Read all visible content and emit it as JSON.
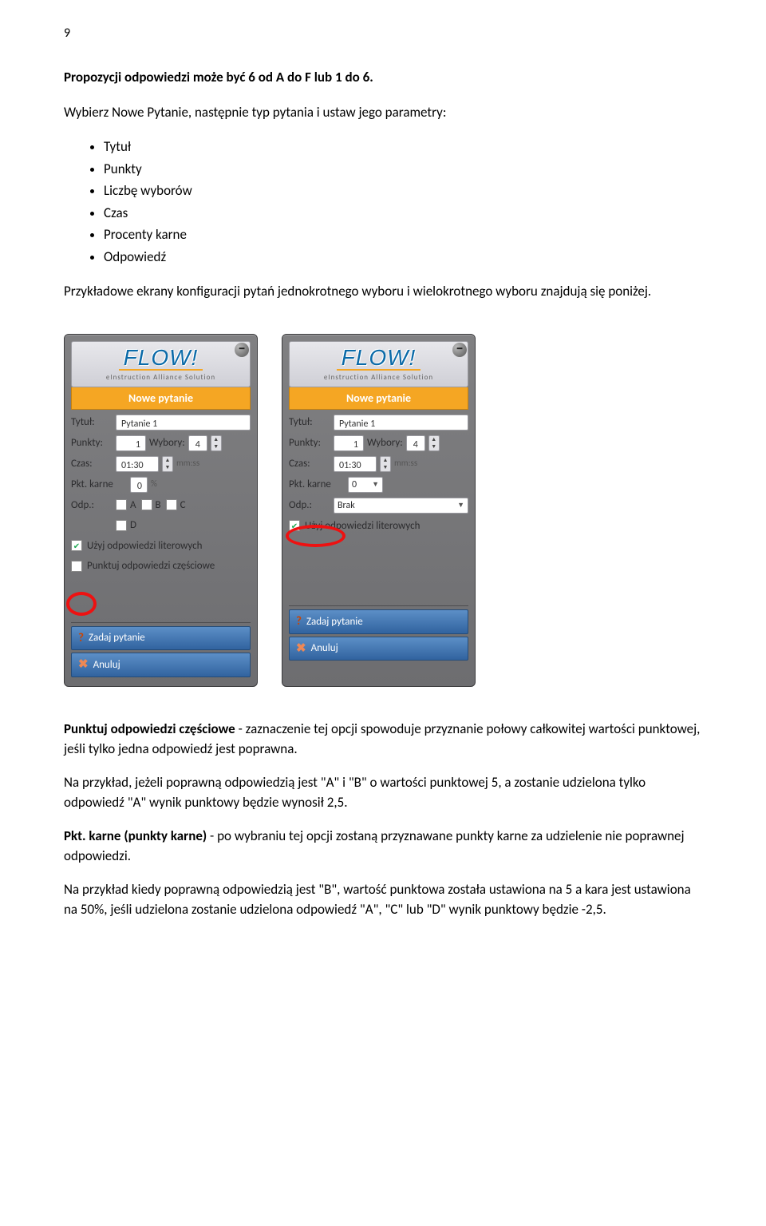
{
  "page_number": "9",
  "intro_line_prefix": "Propozycji odpowiedzi może być 6 od A do F lub 1 do 6.",
  "intro_line2": "Wybierz Nowe Pytanie, następnie typ pytania i ustaw jego parametry:",
  "bullets": {
    "b1": "Tytuł",
    "b2": "Punkty",
    "b3": "Liczbę wyborów",
    "b4": "Czas",
    "b5": "Procenty karne",
    "b6": "Odpowiedź"
  },
  "para_below": "Przykładowe ekrany konfiguracji pytań jednokrotnego wyboru i wielokrotnego wyboru znajdują się poniżej.",
  "widget": {
    "logo": "FLOW!",
    "logo_sub": "eInstruction Alliance Solution",
    "header": "Nowe pytanie",
    "lbl_tytul": "Tytuł:",
    "val_tytul": "Pytanie 1",
    "lbl_punkty": "Punkty:",
    "val_punkty": "1",
    "lbl_wybory": "Wybory:",
    "val_wybory": "4",
    "lbl_czas": "Czas:",
    "val_czas": "01:30",
    "czas_suffix": "mm:ss",
    "lbl_pktkarne": "Pkt. karne",
    "val_pktkarne1": "0",
    "pct": "%",
    "val_pktkarne2": "0",
    "lbl_odp": "Odp.:",
    "optA": "A",
    "optB": "B",
    "optC": "C",
    "optD": "D",
    "odp_brak": "Brak",
    "ck_literowe": "Użyj odpowiedzi literowych",
    "ck_czesciowe": "Punktuj odpowiedzi częściowe",
    "btn_zadaj": "Zadaj pytanie",
    "btn_anuluj": "Anuluj"
  },
  "explain1a": "Punktuj odpowiedzi częściowe",
  "explain1b": " - zaznaczenie tej opcji spowoduje przyznanie połowy całkowitej wartości punktowej, jeśli tylko jedna odpowiedź jest poprawna.",
  "explain2": "Na przykład, jeżeli poprawną odpowiedzią jest \"A\" i \"B\" o wartości punktowej 5, a zostanie udzielona tylko odpowiedź \"A\" wynik punktowy będzie wynosił 2,5.",
  "explain3a": "Pkt. karne (punkty karne)",
  "explain3b": "  - po wybraniu tej opcji zostaną przyznawane punkty karne za udzielenie nie poprawnej odpowiedzi.",
  "explain4": "Na przykład kiedy poprawną odpowiedzią jest \"B\", wartość punktowa została ustawiona na  5 a kara jest ustawiona na 50%, jeśli udzielona zostanie udzielona odpowiedź \"A\", \"C\" lub \"D\" wynik punktowy będzie -2,5."
}
